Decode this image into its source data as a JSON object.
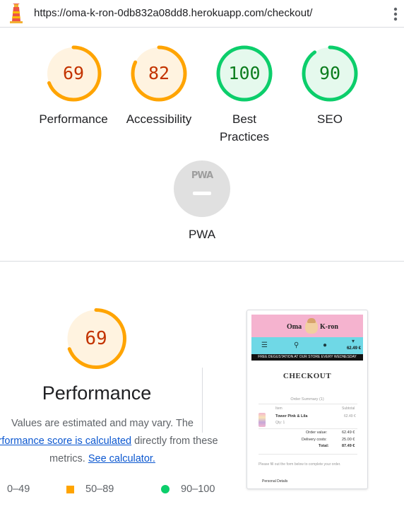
{
  "browser": {
    "url": "https://oma-k-ron-0db832a08dd8.herokuapp.com/checkout/",
    "logo_icon": "lighthouse-icon",
    "menu_icon": "kebab-menu-icon"
  },
  "summary": {
    "categories": [
      {
        "label": "Performance",
        "score": "69",
        "value": 0.69,
        "rating": "average"
      },
      {
        "label": "Accessibility",
        "score": "82",
        "value": 0.82,
        "rating": "average"
      },
      {
        "label": "Best Practices",
        "score": "100",
        "value": 1.0,
        "rating": "pass"
      },
      {
        "label": "SEO",
        "score": "90",
        "value": 0.9,
        "rating": "pass"
      }
    ],
    "pwa": {
      "label": "PWA",
      "badge_text": "PWA"
    }
  },
  "performance": {
    "score": "69",
    "value": 0.69,
    "title": "Performance",
    "desc_line1": "Values are estimated and may vary. The",
    "link_text": "performance score is calculated",
    "desc_mid": " directly from these",
    "desc_line3": "metrics. ",
    "calc_link": "See calculator."
  },
  "legend": {
    "fail": "0–49",
    "average": "50–89",
    "pass": "90–100"
  },
  "colors": {
    "average": "#ffa400",
    "average_bg": "#fff3e0",
    "pass": "#0cce6b",
    "pass_bg": "#e5f9ed",
    "fail": "#ff4e42",
    "na_bg": "#e0e0e0"
  },
  "screenshot": {
    "logo_left": "Oma",
    "logo_right": "K-ron",
    "cart_total": "62.49 €",
    "banner": "FREE DEGUSTATION AT OUR STORE EVERY WEDNESDAY",
    "heading": "CHECKOUT",
    "order_summary": "Order Summary (1)",
    "col_item": "Item",
    "col_subtotal": "Subtotal",
    "product_name": "Tower Pink & Lila",
    "qty": "Qty: 1",
    "product_price": "62.49 €",
    "order_value_label": "Order value:",
    "order_value": "62.49 €",
    "delivery_label": "Delivery costs:",
    "delivery_value": "25.00 €",
    "total_label": "Total:",
    "total_value": "87.49 €",
    "form_note": "Please fill out the form below to complete your order.",
    "personal_details": "Personal Details"
  }
}
